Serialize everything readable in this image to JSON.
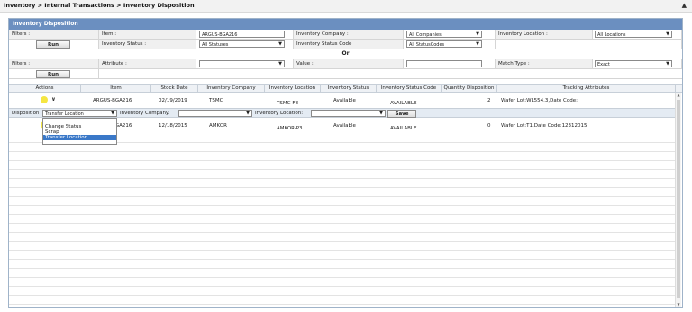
{
  "breadcrumb": "Inventory > Internal Transactions > Inventory Disposition",
  "panel_title": "Inventory Disposition",
  "filters_label": "Filters :",
  "item_label": "Item :",
  "item_value": "ARGUS-BGA216",
  "inventory_company_label": "Inventory Company :",
  "inventory_company_value": "All Companies",
  "inventory_location_label": "Inventory Location :",
  "inventory_location_value": "All Locations",
  "run_label": "Run",
  "inventory_status_label": "Inventory Status :",
  "inventory_status_value": "All Statuses",
  "inventory_status_code_label": "Inventory Status Code",
  "inventory_status_code_value": "All StatusCodes",
  "or_label": "Or",
  "filters2_label": "Filters :",
  "attribute_label": "Attribute :",
  "attribute_value": "",
  "value_label": "Value :",
  "value_value": "",
  "match_type_label": "Match Type :",
  "match_type_value": "Exact",
  "run2_label": "Run",
  "columns": [
    "Actions",
    "Item",
    "Stock Date",
    "Inventory Company",
    "Inventory Location",
    "Inventory Status",
    "Inventory Status Code",
    "Quantity Disposition",
    "Tracking Attributes"
  ],
  "rows": [
    {
      "item": "ARGUS-BGA216",
      "stock_date": "02/19/2019",
      "company": "TSMC",
      "location": "TSMC-F8",
      "status": "Available",
      "status_code": "AVAILABLE",
      "quantity": "2",
      "tracking": "Wafer Lot:WL554.3,Date Code:"
    },
    {
      "item": "ARGUS-BGA216",
      "stock_date": "12/18/2015",
      "company": "AMKOR",
      "location": "AMKOR-P3",
      "status": "Available",
      "status_code": "AVAILABLE",
      "quantity": "0",
      "tracking": "Wafer Lot:T1,Date Code:12312015"
    }
  ],
  "disposition": {
    "label": "Disposition",
    "value": "Transfer Location",
    "company_label": "Inventory Company:",
    "company_value": "",
    "location_label": "Inventory Location:",
    "location_value": "",
    "save_label": "Save",
    "options": [
      "Change Status",
      "Scrap",
      "Transfer Location"
    ]
  },
  "colors": {
    "header": "#6b8fc0",
    "selected_option": "#3a78c8",
    "highlight": "#f5e642"
  }
}
